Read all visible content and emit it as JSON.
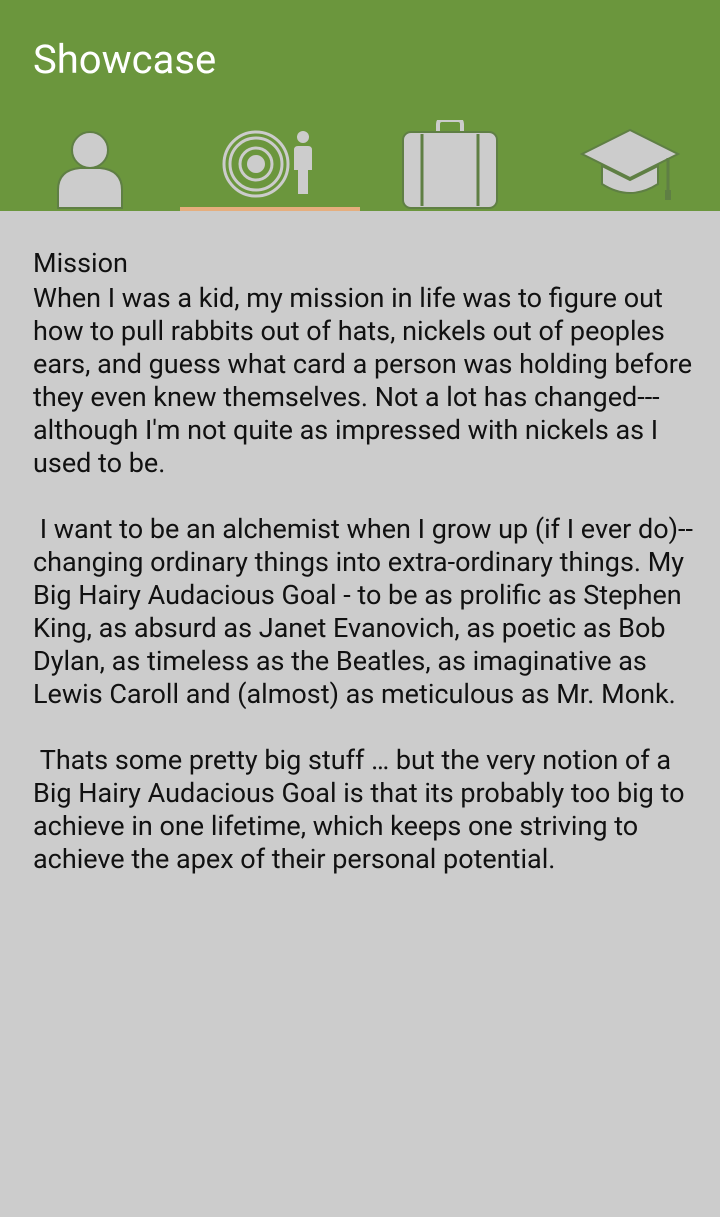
{
  "app": {
    "title": "Showcase",
    "accent": "#6b963d",
    "indicator_color": "#e5ae7e"
  },
  "tabs": [
    {
      "icon": "person-icon",
      "active": false
    },
    {
      "icon": "mission-target-icon",
      "active": true
    },
    {
      "icon": "briefcase-icon",
      "active": false
    },
    {
      "icon": "graduation-cap-icon",
      "active": false
    }
  ],
  "mission": {
    "heading": "Mission",
    "body": "When I was a kid, my mission in life was to figure out how to pull rabbits out of hats, nickels out of peoples ears, and guess what card a person was holding before they even knew themselves. Not a lot has changed--- although I'm not quite as impressed with nickels as I used to be.\n\n I want to be an alchemist when I grow up (if I ever do)-- changing ordinary things into extra-ordinary things. My Big Hairy Audacious Goal - to be as prolific as Stephen King, as absurd as Janet Evanovich, as poetic as Bob Dylan, as timeless as the Beatles, as imaginative as Lewis Caroll and (almost) as meticulous as Mr. Monk.\n\n Thats some pretty big stuff … but the very notion of a Big Hairy Audacious Goal is that its probably too big to achieve in one lifetime, which keeps one striving to achieve the apex of their personal potential."
  }
}
